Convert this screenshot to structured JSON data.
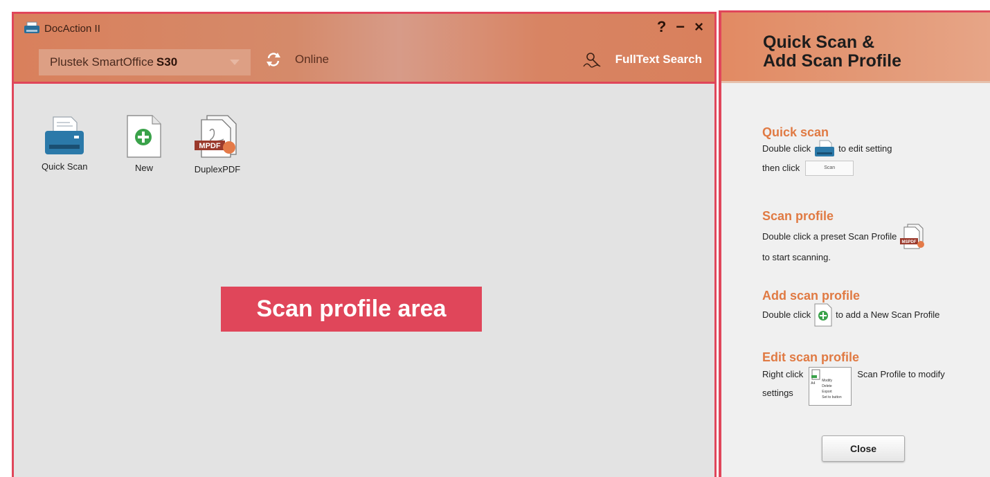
{
  "window": {
    "title": "DocAction II",
    "controls": {
      "help": "?",
      "minimize": "−",
      "close": "×"
    }
  },
  "toolbar": {
    "scanner_name_prefix": "Plustek SmartOffice",
    "scanner_model": "S30",
    "status": "Online",
    "fulltext_search_label": "FullText Search"
  },
  "profiles": [
    {
      "label": "Quick Scan",
      "icon": "scanner-icon"
    },
    {
      "label": "New",
      "icon": "new-profile-icon"
    },
    {
      "label": "DuplexPDF",
      "icon": "pdf-profile-icon",
      "badge": "MPDF"
    }
  ],
  "area_label": "Scan profile area",
  "help": {
    "title_line1": "Quick Scan &",
    "title_line2": "Add Scan Profile",
    "quick_scan": {
      "heading": "Quick scan",
      "line1_pre": "Double click",
      "line1_post": "to edit setting",
      "line2_pre": "then click",
      "scan_button": "Scan"
    },
    "scan_profile": {
      "heading": "Scan profile",
      "line1": "Double click a preset Scan Profile",
      "line2": "to start scanning.",
      "badge": "MSPDF"
    },
    "add_profile": {
      "heading": "Add scan profile",
      "line1_pre": "Double click",
      "line1_post": "to add a New Scan Profile"
    },
    "edit_profile": {
      "heading": "Edit scan profile",
      "line1_pre": "Right click",
      "line1_post": "Scan Profile  to modify",
      "line2": "settings",
      "menu_items": [
        "Modify",
        "Delete",
        "Export",
        "Set to button"
      ],
      "menu_tag": "A4"
    },
    "close_button": "Close"
  },
  "colors": {
    "accent": "#e0465a",
    "header_orange": "#d9805c",
    "heading_orange": "#e07a43"
  }
}
